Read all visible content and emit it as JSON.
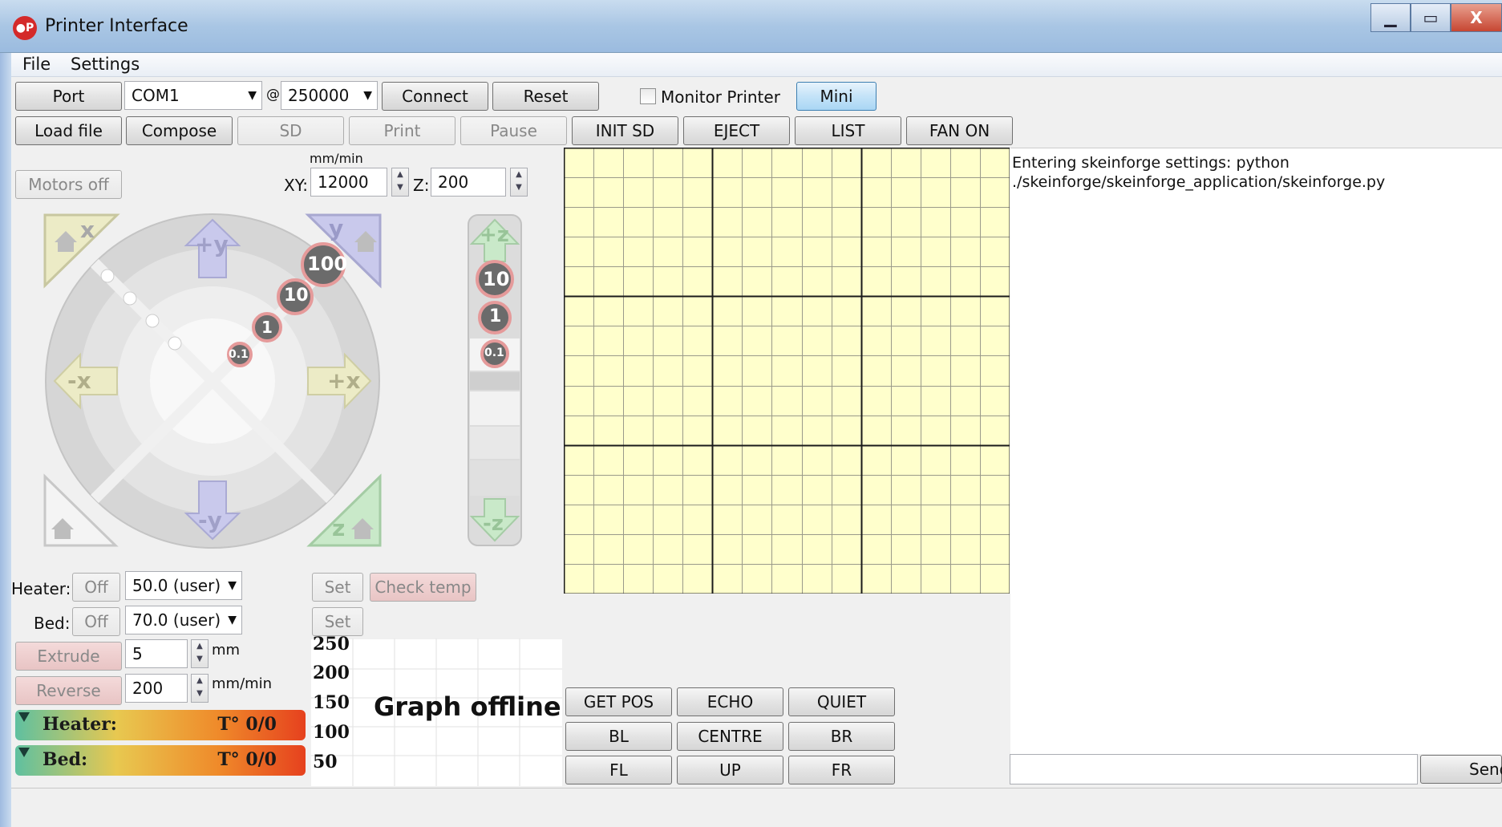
{
  "window": {
    "title": "Printer Interface",
    "icon": "printrun-logo-icon",
    "minimize": "▁",
    "maximize": "▭",
    "close": "X"
  },
  "menu": [
    "File",
    "Settings"
  ],
  "toolbar1": {
    "port_label": "Port",
    "port_value": "COM1",
    "at": "@",
    "baud_value": "250000",
    "connect": "Connect",
    "reset": "Reset",
    "monitor_label": "Monitor Printer",
    "monitor_checked": false,
    "mini_mode": "Mini mode"
  },
  "toolbar2": {
    "load_file": "Load file",
    "compose": "Compose",
    "sd": "SD",
    "print": "Print",
    "pause": "Pause",
    "init_sd": "INIT SD",
    "eject": "EJECT",
    "list": "LIST",
    "fan_on": "FAN ON"
  },
  "motion": {
    "motors_off": "Motors off",
    "unit": "mm/min",
    "xy_label": "XY:",
    "xy_value": "12000",
    "z_label": "Z:",
    "z_value": "200"
  },
  "jog": {
    "home_x": "x",
    "home_y": "y",
    "home_z": "z",
    "plus_y": "+y",
    "minus_y": "-y",
    "plus_x": "+x",
    "minus_x": "-x",
    "steps": [
      "100",
      "10",
      "1",
      "0.1"
    ],
    "z_plus": "+z",
    "z_minus": "-z",
    "z_steps": [
      "10",
      "1",
      "0.1"
    ]
  },
  "temps": {
    "heater_label": "Heater:",
    "heater_off": "Off",
    "heater_value": "50.0 (user)",
    "heater_set": "Set",
    "check_temp": "Check temp",
    "bed_label": "Bed:",
    "bed_off": "Off",
    "bed_value": "70.0 (user)",
    "bed_set": "Set"
  },
  "extrude": {
    "extrude": "Extrude",
    "amount": "5",
    "amount_unit": "mm",
    "reverse": "Reverse",
    "speed": "200",
    "speed_unit": "mm/min"
  },
  "tempbars": {
    "heater_label": "Heater:",
    "heater_value": "T° 0/0",
    "bed_label": "Bed:",
    "bed_value": "T° 0/0"
  },
  "graph": {
    "y_ticks": [
      "250",
      "200",
      "150",
      "100",
      "50"
    ],
    "offline_text": "Graph offline"
  },
  "macros": {
    "get_pos": "GET POS",
    "echo": "ECHO",
    "quiet": "QUIET",
    "bl": "BL",
    "centre": "CENTRE",
    "br": "BR",
    "fl": "FL",
    "up": "UP",
    "fr": "FR"
  },
  "log": {
    "lines": [
      "Entering skeinforge settings:  python",
      "./skeinforge/skeinforge_application/skeinforge.py"
    ],
    "send": "Send",
    "command_value": ""
  },
  "colors": {
    "grid_bg": "#ffffcc",
    "mini_mode_bg": "#c4e3f8"
  }
}
